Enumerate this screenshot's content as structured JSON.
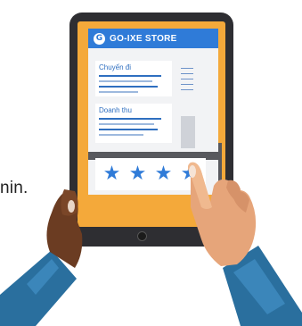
{
  "app": {
    "brand_letter": "G",
    "title": "GO-IXE STORE",
    "cards": [
      {
        "title": "Chuyến đi"
      },
      {
        "title": "Doanh thu"
      }
    ],
    "rating": {
      "stars": 4,
      "max": 4
    }
  },
  "background_text": "nin.",
  "icons": [
    "logo-icon",
    "star-icon"
  ],
  "colors": {
    "accent": "#2f7bd8",
    "screen_background": "#f4a93a",
    "tablet_frame": "#2e2e32",
    "sleeve": "#2a6f9e"
  }
}
